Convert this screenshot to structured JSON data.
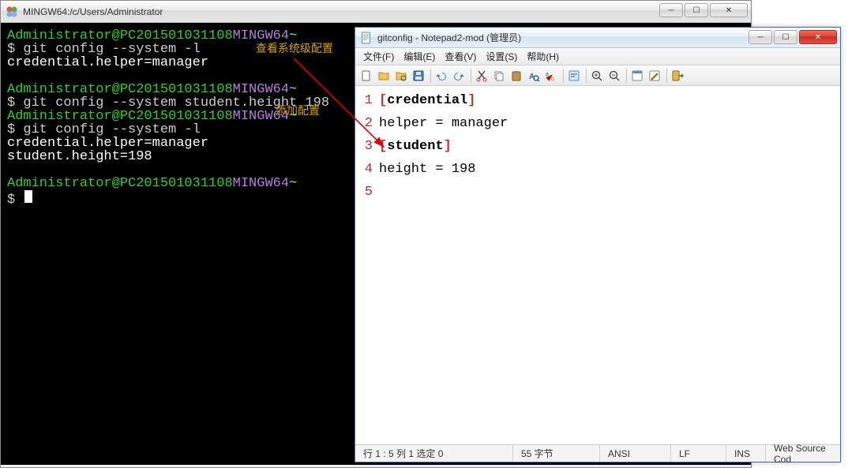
{
  "terminal": {
    "title": "MINGW64:/c/Users/Administrator",
    "prompt_user": "Administrator@PC201501031108",
    "prompt_env": "MINGW64",
    "prompt_path": "~",
    "lines": [
      {
        "cmd": "git config --system -l",
        "annot": "查看系统级配置"
      },
      {
        "out": "credential.helper=manager"
      },
      {
        "blank": true
      },
      {
        "prompt": true
      },
      {
        "cmd": "git config --system student.height 198",
        "annot": "添加配置",
        "annot_below": true
      },
      {
        "prompt": true
      },
      {
        "cmd": "git config --system -l"
      },
      {
        "out": "credential.helper=manager"
      },
      {
        "out": "student.height=198"
      },
      {
        "blank": true
      },
      {
        "prompt": true
      },
      {
        "cursor": true
      }
    ]
  },
  "notepad": {
    "title": "gitconfig - Notepad2-mod (管理员)",
    "menus": {
      "file": "文件(F)",
      "edit": "编辑(E)",
      "view": "查看(V)",
      "settings": "设置(S)",
      "help": "帮助(H)"
    },
    "toolbar_icons": [
      "new-icon",
      "open-icon",
      "browse-icon",
      "save-icon",
      "sep",
      "undo-icon",
      "redo-icon",
      "sep",
      "cut-icon",
      "copy-icon",
      "paste-icon",
      "find-icon",
      "replace-icon",
      "sep",
      "wordwrap-icon",
      "sep",
      "zoom-in-icon",
      "zoom-out-icon",
      "sep",
      "scheme-icon",
      "customize-icon",
      "sep",
      "exit-icon"
    ],
    "lines": [
      {
        "n": "1",
        "html": "<span class='br'>[</span><span class='sec'>credential</span><span class='br'>]</span>"
      },
      {
        "n": "2",
        "html": "    helper = manager"
      },
      {
        "n": "3",
        "html": "<span class='br'>[</span><span class='sec'>student</span><span class='br'>]</span>",
        "is_section": true
      },
      {
        "n": "4",
        "html": "    height = 198"
      },
      {
        "n": "5",
        "html": ""
      }
    ],
    "status": {
      "pos": "行 1 : 5  列 1  选定 0",
      "bytes": "55 字节",
      "enc": "ANSI",
      "eol": "LF",
      "ins": "INS",
      "scheme": "Web Source Cod"
    }
  }
}
